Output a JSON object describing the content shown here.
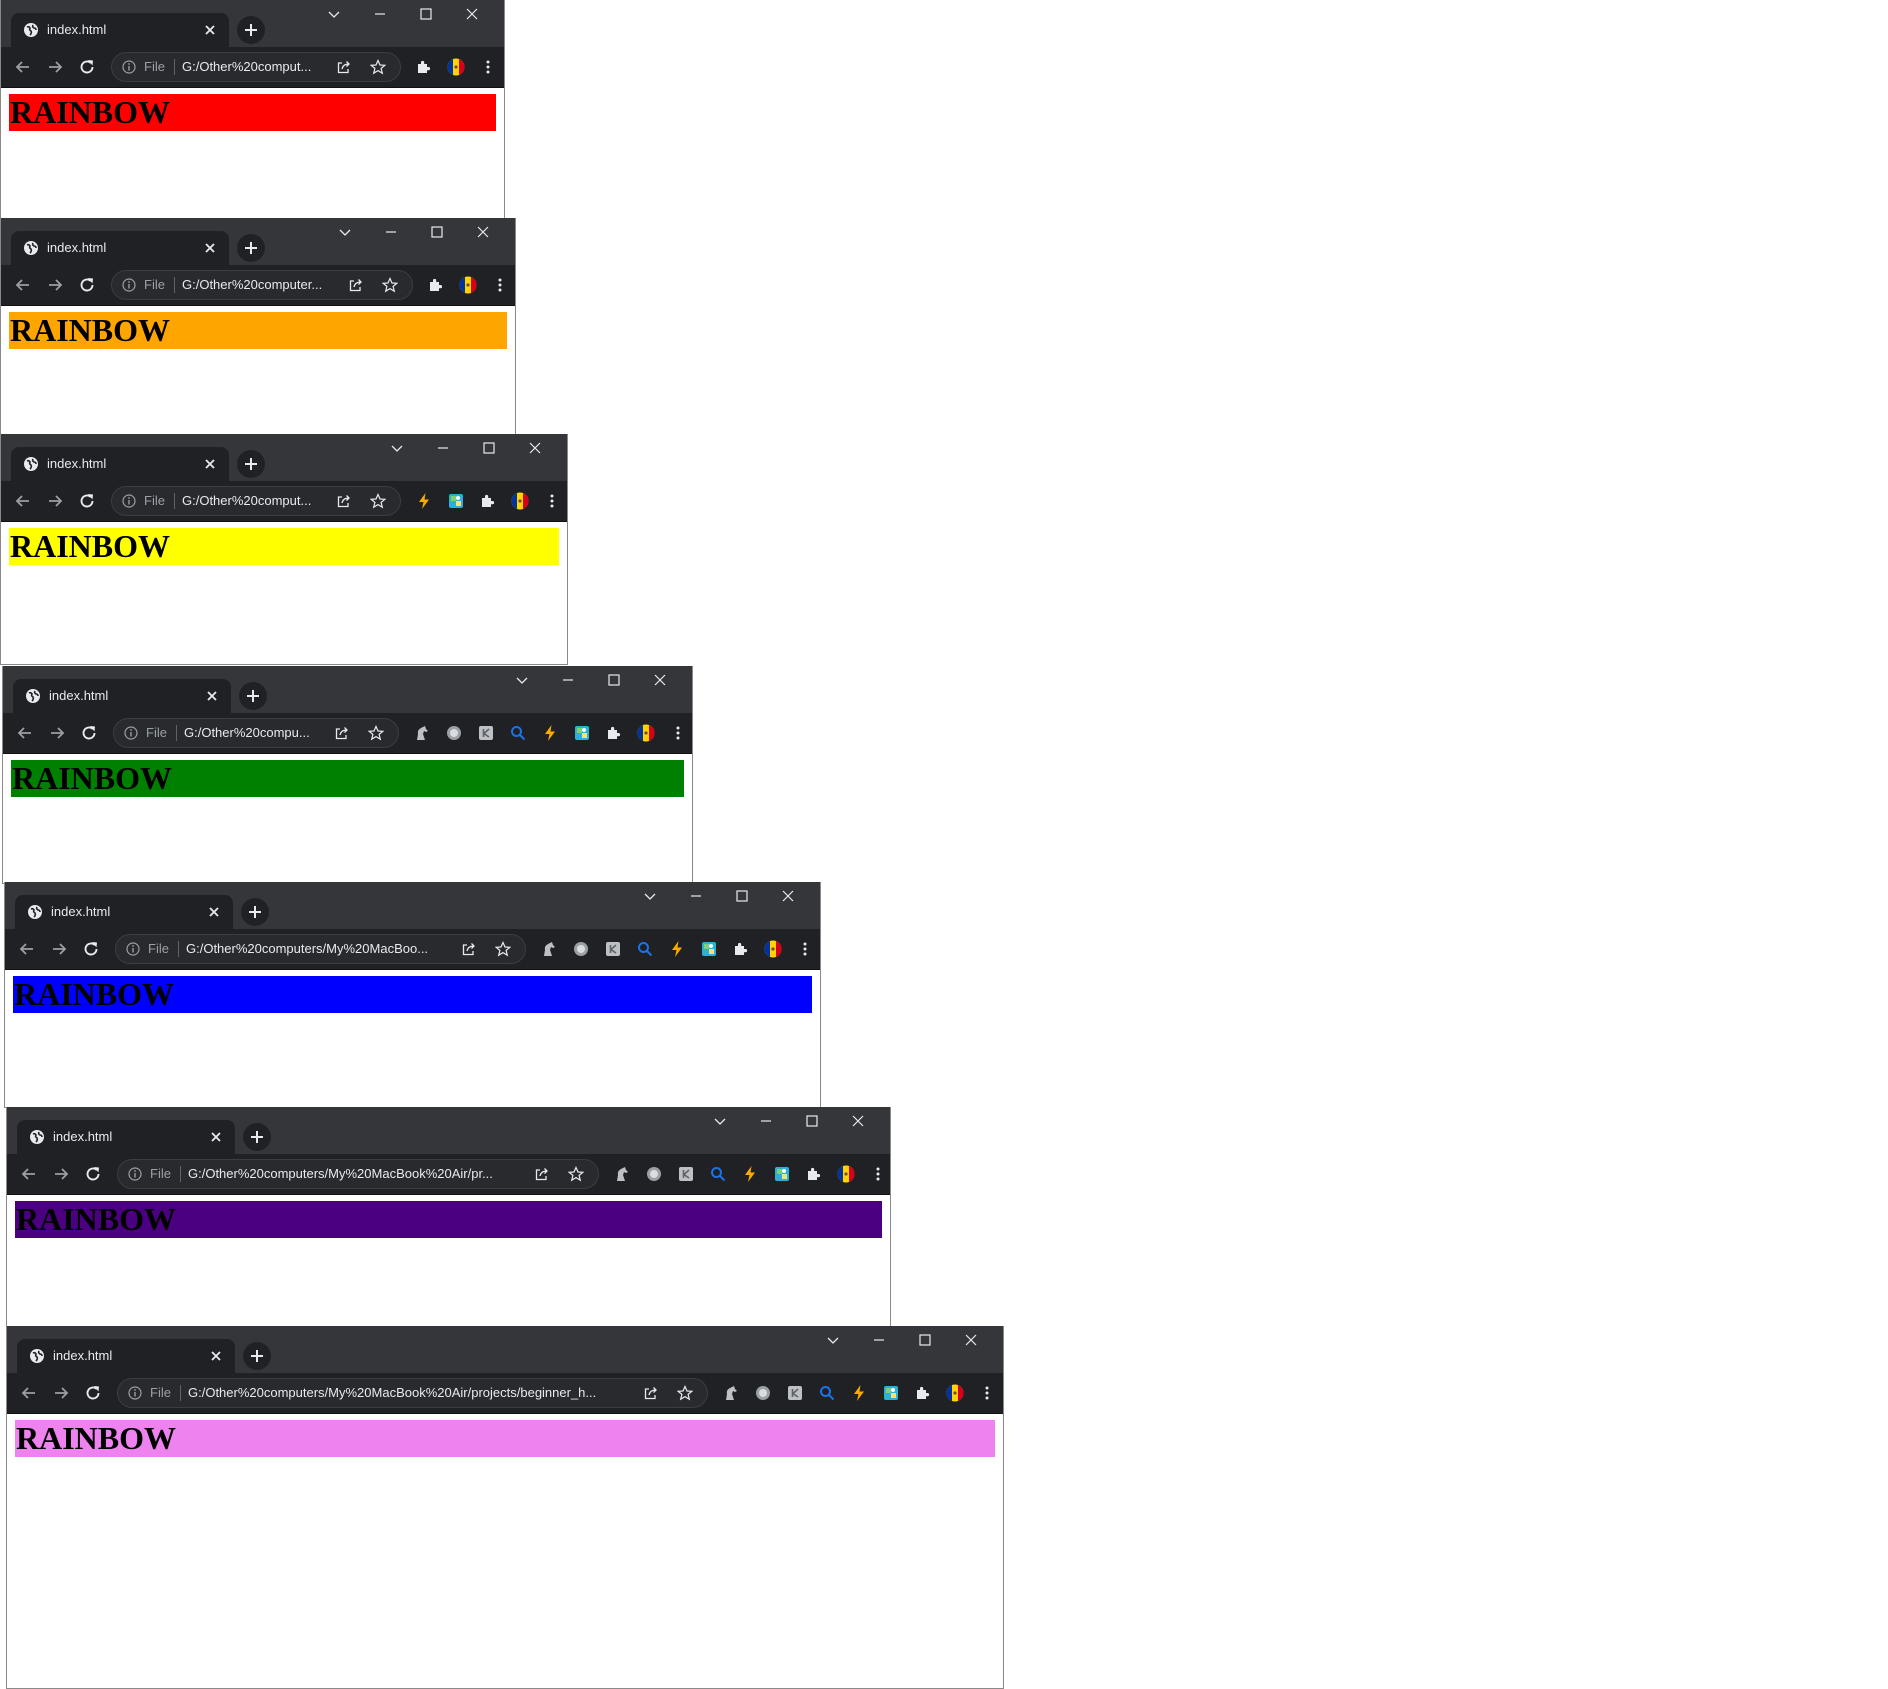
{
  "browser": {
    "tab_title": "index.html",
    "file_chip": "File",
    "heading_text": "RAINBOW"
  },
  "windows": [
    {
      "url": "G:/Other%20comput...",
      "bg": "#ff0000",
      "icons": []
    },
    {
      "url": "G:/Other%20computer...",
      "bg": "#ffa500",
      "icons": []
    },
    {
      "url": "G:/Other%20comput...",
      "bg": "#ffff00",
      "icons": [
        "bolt-icon",
        "map-icon"
      ]
    },
    {
      "url": "G:/Other%20compu...",
      "bg": "#008000",
      "icons": [
        "horse-icon",
        "circle-icon",
        "letter-k-icon",
        "search-icon",
        "bolt-icon",
        "map-icon"
      ]
    },
    {
      "url": "G:/Other%20computers/My%20MacBoo...",
      "bg": "#0000ff",
      "icons": [
        "horse-icon",
        "circle-icon",
        "letter-k-icon",
        "search-icon",
        "bolt-icon",
        "map-icon"
      ]
    },
    {
      "url": "G:/Other%20computers/My%20MacBook%20Air/pr...",
      "bg": "#4b0082",
      "icons": [
        "horse-icon",
        "circle-icon",
        "letter-k-icon",
        "search-icon",
        "bolt-icon",
        "map-icon"
      ]
    },
    {
      "url": "G:/Other%20computers/My%20MacBook%20Air/projects/beginner_h...",
      "bg": "#ee82ee",
      "icons": [
        "horse-icon",
        "circle-icon",
        "letter-k-icon",
        "search-icon",
        "bolt-icon",
        "map-icon"
      ]
    }
  ]
}
